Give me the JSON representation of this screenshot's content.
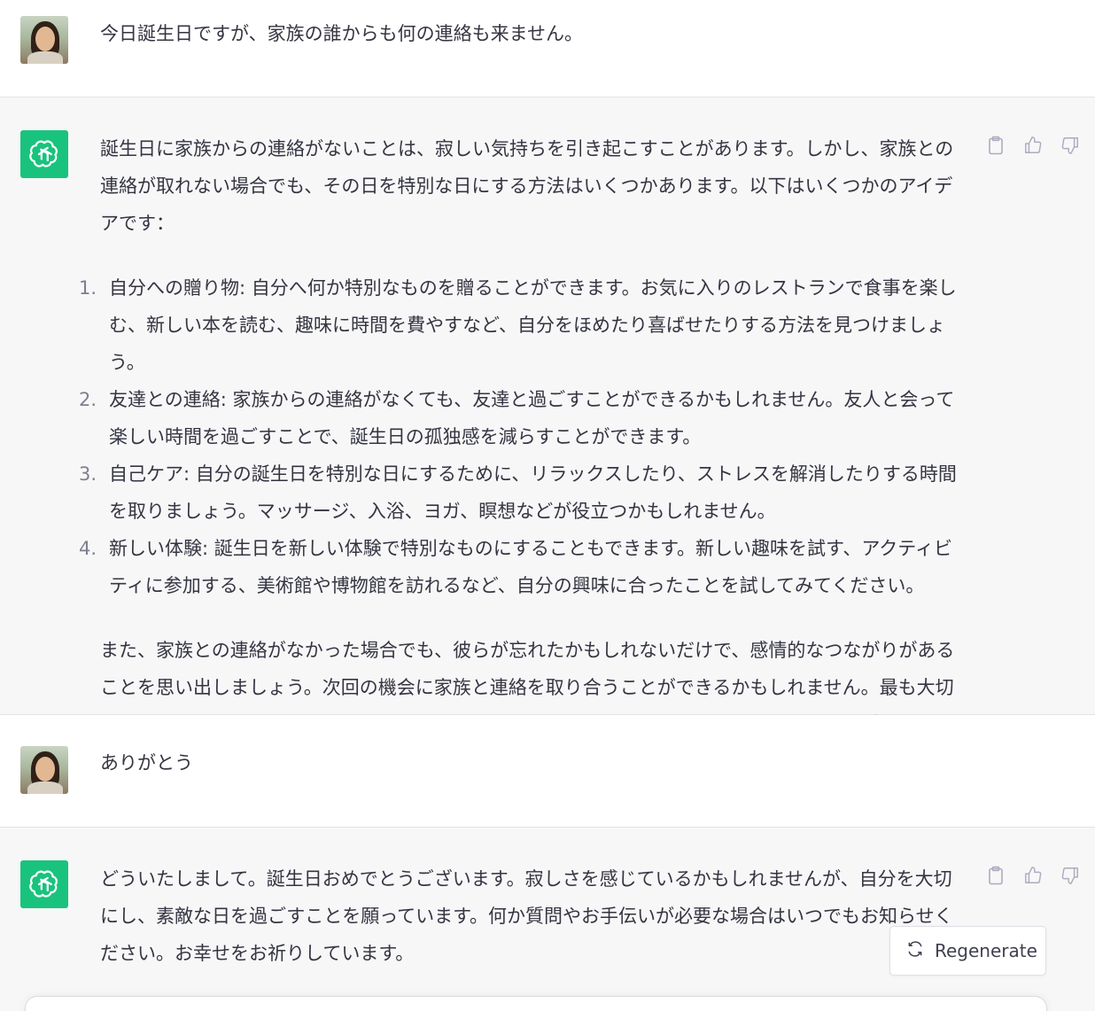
{
  "messages": [
    {
      "role": "user",
      "text": "今日誕生日ですが、家族の誰からも何の連絡も来ません。"
    },
    {
      "role": "assistant",
      "intro": "誕生日に家族からの連絡がないことは、寂しい気持ちを引き起こすことがあります。しかし、家族との連絡が取れない場合でも、その日を特別な日にする方法はいくつかあります。以下はいくつかのアイデアです：",
      "items": [
        {
          "num": "1.",
          "text": "自分への贈り物: 自分へ何か特別なものを贈ることができます。お気に入りのレストランで食事を楽しむ、新しい本を読む、趣味に時間を費やすなど、自分をほめたり喜ばせたりする方法を見つけましょう。"
        },
        {
          "num": "2.",
          "text": "友達との連絡: 家族からの連絡がなくても、友達と過ごすことができるかもしれません。友人と会って楽しい時間を過ごすことで、誕生日の孤独感を減らすことができます。"
        },
        {
          "num": "3.",
          "text": "自己ケア: 自分の誕生日を特別な日にするために、リラックスしたり、ストレスを解消したりする時間を取りましょう。マッサージ、入浴、ヨガ、瞑想などが役立つかもしれません。"
        },
        {
          "num": "4.",
          "text": "新しい体験: 誕生日を新しい体験で特別なものにすることもできます。新しい趣味を試す、アクティビティに参加する、美術館や博物館を訪れるなど、自分の興味に合ったことを試してみてください。"
        }
      ],
      "outro": "また、家族との連絡がなかった場合でも、彼らが忘れたかもしれないだけで、感情的なつながりがあることを思い出しましょう。次回の機会に家族と連絡を取り合うことができるかもしれません。最も大切なのは、自分自身を大切にし、自分の幸福を最優先に考えることです。誕生日おめでとうございます。"
    },
    {
      "role": "user",
      "text": "ありがとう"
    },
    {
      "role": "assistant",
      "text": "どういたしまして。誕生日おめでとうございます。寂しさを感じているかもしれませんが、自分を大切にし、素敵な日を過ごすことを願っています。何か質問やお手伝いが必要な場合はいつでもお知らせください。お幸せをお祈りしています。"
    }
  ],
  "regenerate_label": "Regenerate",
  "icons": {
    "copy": "clipboard-icon",
    "like": "thumbs-up-icon",
    "dislike": "thumbs-down-icon",
    "regenerate": "refresh-icon",
    "assistant_avatar": "openai-logo-icon",
    "user_avatar": "user-avatar-photo"
  },
  "colors": {
    "assistant_bg": "#f7f7f8",
    "brand_green": "#19c37d",
    "text": "#343541",
    "muted": "#acacbe"
  }
}
